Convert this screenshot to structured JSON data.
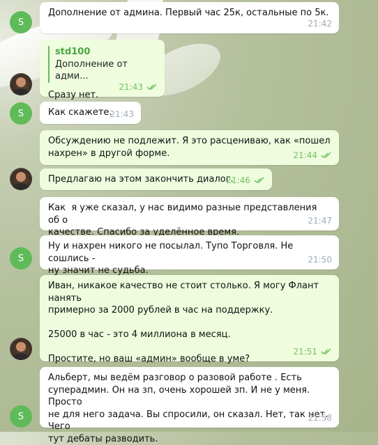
{
  "avatars": {
    "s_letter": "S"
  },
  "messages": [
    {
      "text": "Дополнение от админа. Первый час 25к, остальные по 5к.",
      "time": "21:42"
    },
    {
      "reply_author": "std100",
      "reply_text": "Дополнение от адми...",
      "text": "Сразу нет.",
      "time": "21:43"
    },
    {
      "text": "Как скажете.",
      "time": "21:43"
    },
    {
      "text": "Обсуждению не подлежит. Я это расцениваю, как «пошел\nнахрен» в другой форме.",
      "time": "21:44"
    },
    {
      "text": "Предлагаю на этом закончить диалог.",
      "time": "21:46"
    },
    {
      "text": "Как  я уже сказал, у нас видимо разные представления об о\nкачестве. Спасибо за уделённое время.",
      "time": "21:47"
    },
    {
      "text": "Ну и нахрен никого не посылал. Тупо Торговля. Не сошлись -\nну значит не судьба.",
      "time": "21:50"
    },
    {
      "text": "Иван, никакое качество не стоит столько. Я могу Флант нанять\nпримерно за 2000 рублей в час на поддержку.\n\n25000 в час - это 4 миллиона в месяц.\n\nПростите, но ваш «админ» вообще в уме?",
      "time": "21:51"
    },
    {
      "text": "Альберт, мы ведём разговор о разовой работе . Есть\nсуперадмин. Он на зп, очень хорошей зп. И не у меня. Просто\nне для него задача. Вы спросили, он сказал. Нет, так нет. Чего\nтут дебаты разводить.",
      "time": "21:58"
    }
  ]
}
